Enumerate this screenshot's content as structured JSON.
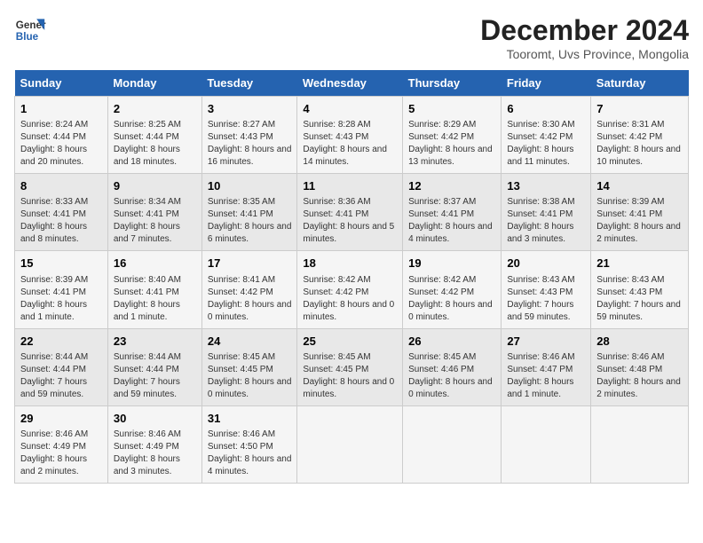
{
  "logo": {
    "line1": "General",
    "line2": "Blue"
  },
  "title": "December 2024",
  "subtitle": "Tooromt, Uvs Province, Mongolia",
  "days_of_week": [
    "Sunday",
    "Monday",
    "Tuesday",
    "Wednesday",
    "Thursday",
    "Friday",
    "Saturday"
  ],
  "weeks": [
    [
      {
        "day": "1",
        "sunrise": "Sunrise: 8:24 AM",
        "sunset": "Sunset: 4:44 PM",
        "daylight": "Daylight: 8 hours and 20 minutes."
      },
      {
        "day": "2",
        "sunrise": "Sunrise: 8:25 AM",
        "sunset": "Sunset: 4:44 PM",
        "daylight": "Daylight: 8 hours and 18 minutes."
      },
      {
        "day": "3",
        "sunrise": "Sunrise: 8:27 AM",
        "sunset": "Sunset: 4:43 PM",
        "daylight": "Daylight: 8 hours and 16 minutes."
      },
      {
        "day": "4",
        "sunrise": "Sunrise: 8:28 AM",
        "sunset": "Sunset: 4:43 PM",
        "daylight": "Daylight: 8 hours and 14 minutes."
      },
      {
        "day": "5",
        "sunrise": "Sunrise: 8:29 AM",
        "sunset": "Sunset: 4:42 PM",
        "daylight": "Daylight: 8 hours and 13 minutes."
      },
      {
        "day": "6",
        "sunrise": "Sunrise: 8:30 AM",
        "sunset": "Sunset: 4:42 PM",
        "daylight": "Daylight: 8 hours and 11 minutes."
      },
      {
        "day": "7",
        "sunrise": "Sunrise: 8:31 AM",
        "sunset": "Sunset: 4:42 PM",
        "daylight": "Daylight: 8 hours and 10 minutes."
      }
    ],
    [
      {
        "day": "8",
        "sunrise": "Sunrise: 8:33 AM",
        "sunset": "Sunset: 4:41 PM",
        "daylight": "Daylight: 8 hours and 8 minutes."
      },
      {
        "day": "9",
        "sunrise": "Sunrise: 8:34 AM",
        "sunset": "Sunset: 4:41 PM",
        "daylight": "Daylight: 8 hours and 7 minutes."
      },
      {
        "day": "10",
        "sunrise": "Sunrise: 8:35 AM",
        "sunset": "Sunset: 4:41 PM",
        "daylight": "Daylight: 8 hours and 6 minutes."
      },
      {
        "day": "11",
        "sunrise": "Sunrise: 8:36 AM",
        "sunset": "Sunset: 4:41 PM",
        "daylight": "Daylight: 8 hours and 5 minutes."
      },
      {
        "day": "12",
        "sunrise": "Sunrise: 8:37 AM",
        "sunset": "Sunset: 4:41 PM",
        "daylight": "Daylight: 8 hours and 4 minutes."
      },
      {
        "day": "13",
        "sunrise": "Sunrise: 8:38 AM",
        "sunset": "Sunset: 4:41 PM",
        "daylight": "Daylight: 8 hours and 3 minutes."
      },
      {
        "day": "14",
        "sunrise": "Sunrise: 8:39 AM",
        "sunset": "Sunset: 4:41 PM",
        "daylight": "Daylight: 8 hours and 2 minutes."
      }
    ],
    [
      {
        "day": "15",
        "sunrise": "Sunrise: 8:39 AM",
        "sunset": "Sunset: 4:41 PM",
        "daylight": "Daylight: 8 hours and 1 minute."
      },
      {
        "day": "16",
        "sunrise": "Sunrise: 8:40 AM",
        "sunset": "Sunset: 4:41 PM",
        "daylight": "Daylight: 8 hours and 1 minute."
      },
      {
        "day": "17",
        "sunrise": "Sunrise: 8:41 AM",
        "sunset": "Sunset: 4:42 PM",
        "daylight": "Daylight: 8 hours and 0 minutes."
      },
      {
        "day": "18",
        "sunrise": "Sunrise: 8:42 AM",
        "sunset": "Sunset: 4:42 PM",
        "daylight": "Daylight: 8 hours and 0 minutes."
      },
      {
        "day": "19",
        "sunrise": "Sunrise: 8:42 AM",
        "sunset": "Sunset: 4:42 PM",
        "daylight": "Daylight: 8 hours and 0 minutes."
      },
      {
        "day": "20",
        "sunrise": "Sunrise: 8:43 AM",
        "sunset": "Sunset: 4:43 PM",
        "daylight": "Daylight: 7 hours and 59 minutes."
      },
      {
        "day": "21",
        "sunrise": "Sunrise: 8:43 AM",
        "sunset": "Sunset: 4:43 PM",
        "daylight": "Daylight: 7 hours and 59 minutes."
      }
    ],
    [
      {
        "day": "22",
        "sunrise": "Sunrise: 8:44 AM",
        "sunset": "Sunset: 4:44 PM",
        "daylight": "Daylight: 7 hours and 59 minutes."
      },
      {
        "day": "23",
        "sunrise": "Sunrise: 8:44 AM",
        "sunset": "Sunset: 4:44 PM",
        "daylight": "Daylight: 7 hours and 59 minutes."
      },
      {
        "day": "24",
        "sunrise": "Sunrise: 8:45 AM",
        "sunset": "Sunset: 4:45 PM",
        "daylight": "Daylight: 8 hours and 0 minutes."
      },
      {
        "day": "25",
        "sunrise": "Sunrise: 8:45 AM",
        "sunset": "Sunset: 4:45 PM",
        "daylight": "Daylight: 8 hours and 0 minutes."
      },
      {
        "day": "26",
        "sunrise": "Sunrise: 8:45 AM",
        "sunset": "Sunset: 4:46 PM",
        "daylight": "Daylight: 8 hours and 0 minutes."
      },
      {
        "day": "27",
        "sunrise": "Sunrise: 8:46 AM",
        "sunset": "Sunset: 4:47 PM",
        "daylight": "Daylight: 8 hours and 1 minute."
      },
      {
        "day": "28",
        "sunrise": "Sunrise: 8:46 AM",
        "sunset": "Sunset: 4:48 PM",
        "daylight": "Daylight: 8 hours and 2 minutes."
      }
    ],
    [
      {
        "day": "29",
        "sunrise": "Sunrise: 8:46 AM",
        "sunset": "Sunset: 4:49 PM",
        "daylight": "Daylight: 8 hours and 2 minutes."
      },
      {
        "day": "30",
        "sunrise": "Sunrise: 8:46 AM",
        "sunset": "Sunset: 4:49 PM",
        "daylight": "Daylight: 8 hours and 3 minutes."
      },
      {
        "day": "31",
        "sunrise": "Sunrise: 8:46 AM",
        "sunset": "Sunset: 4:50 PM",
        "daylight": "Daylight: 8 hours and 4 minutes."
      },
      null,
      null,
      null,
      null
    ]
  ]
}
